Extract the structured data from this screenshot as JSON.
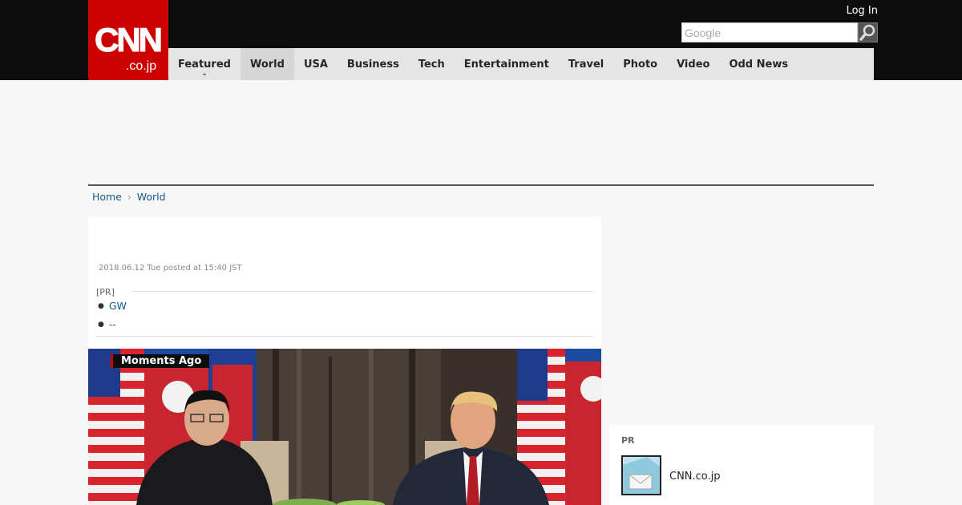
{
  "header": {
    "logo": {
      "line1": "CNN",
      "line2": ".co.jp"
    },
    "login_label": "Log In",
    "search_placeholder": "Google"
  },
  "nav": [
    {
      "label": "Featured",
      "has_dropdown": true,
      "active": false
    },
    {
      "label": "World",
      "active": true
    },
    {
      "label": "USA",
      "active": false
    },
    {
      "label": "Business",
      "active": false
    },
    {
      "label": "Tech",
      "active": false
    },
    {
      "label": "Entertainment",
      "active": false
    },
    {
      "label": "Travel",
      "active": false
    },
    {
      "label": "Photo",
      "active": false
    },
    {
      "label": "Video",
      "active": false
    },
    {
      "label": "Odd News",
      "active": false
    }
  ],
  "breadcrumb": [
    {
      "label": "Home"
    },
    {
      "label": "World"
    }
  ],
  "article": {
    "dateline": "2018.06.12 Tue posted at 15:40 JST",
    "pr_label": "[PR]",
    "pr_links": [
      {
        "label": "GW"
      },
      {
        "label": "--"
      }
    ]
  },
  "video": {
    "badge": "Moments Ago"
  },
  "sidebar_pr": {
    "title": "PR",
    "text": "CNN.co.jp"
  },
  "colors": {
    "brand_red": "#cc0000",
    "link_blue": "#125b8c",
    "topbar": "#0c0c0c",
    "nav_bg": "#e5e5e5"
  }
}
